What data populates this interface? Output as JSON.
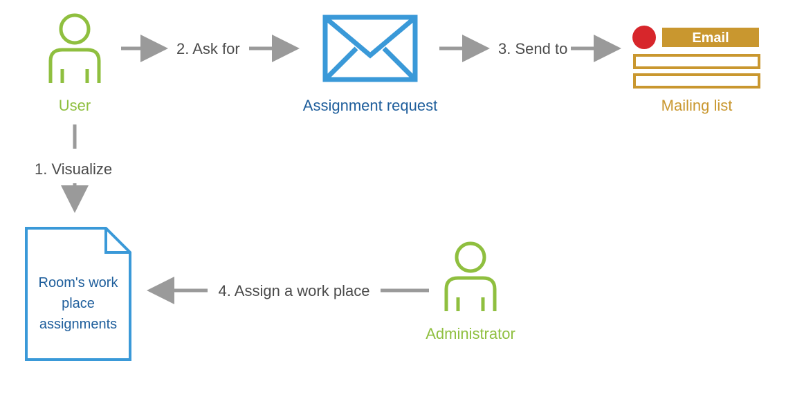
{
  "nodes": {
    "user": {
      "label": "User",
      "color": "#8fbf3f"
    },
    "assignment_request": {
      "label": "Assignment request",
      "color": "#1d5d9b"
    },
    "mailing_list": {
      "label": "Mailing list",
      "badge": "Email",
      "color": "#c9972f"
    },
    "document": {
      "line1": "Room's work",
      "line2": "place",
      "line3": "assignments",
      "color": "#1d5d9b"
    },
    "administrator": {
      "label": "Administrator",
      "color": "#8fbf3f"
    }
  },
  "edges": {
    "visualize": {
      "label": "1. Visualize"
    },
    "ask_for": {
      "label": "2. Ask for"
    },
    "send_to": {
      "label": "3. Send to"
    },
    "assign": {
      "label": "4. Assign a work place"
    }
  },
  "colors": {
    "green": "#8fbf3f",
    "blue": "#3a99d8",
    "darkblue": "#1d5d9b",
    "gold": "#c9972f",
    "grey": "#9a9a9a",
    "red": "#d7262b",
    "text_grey": "#4b4b4b"
  }
}
